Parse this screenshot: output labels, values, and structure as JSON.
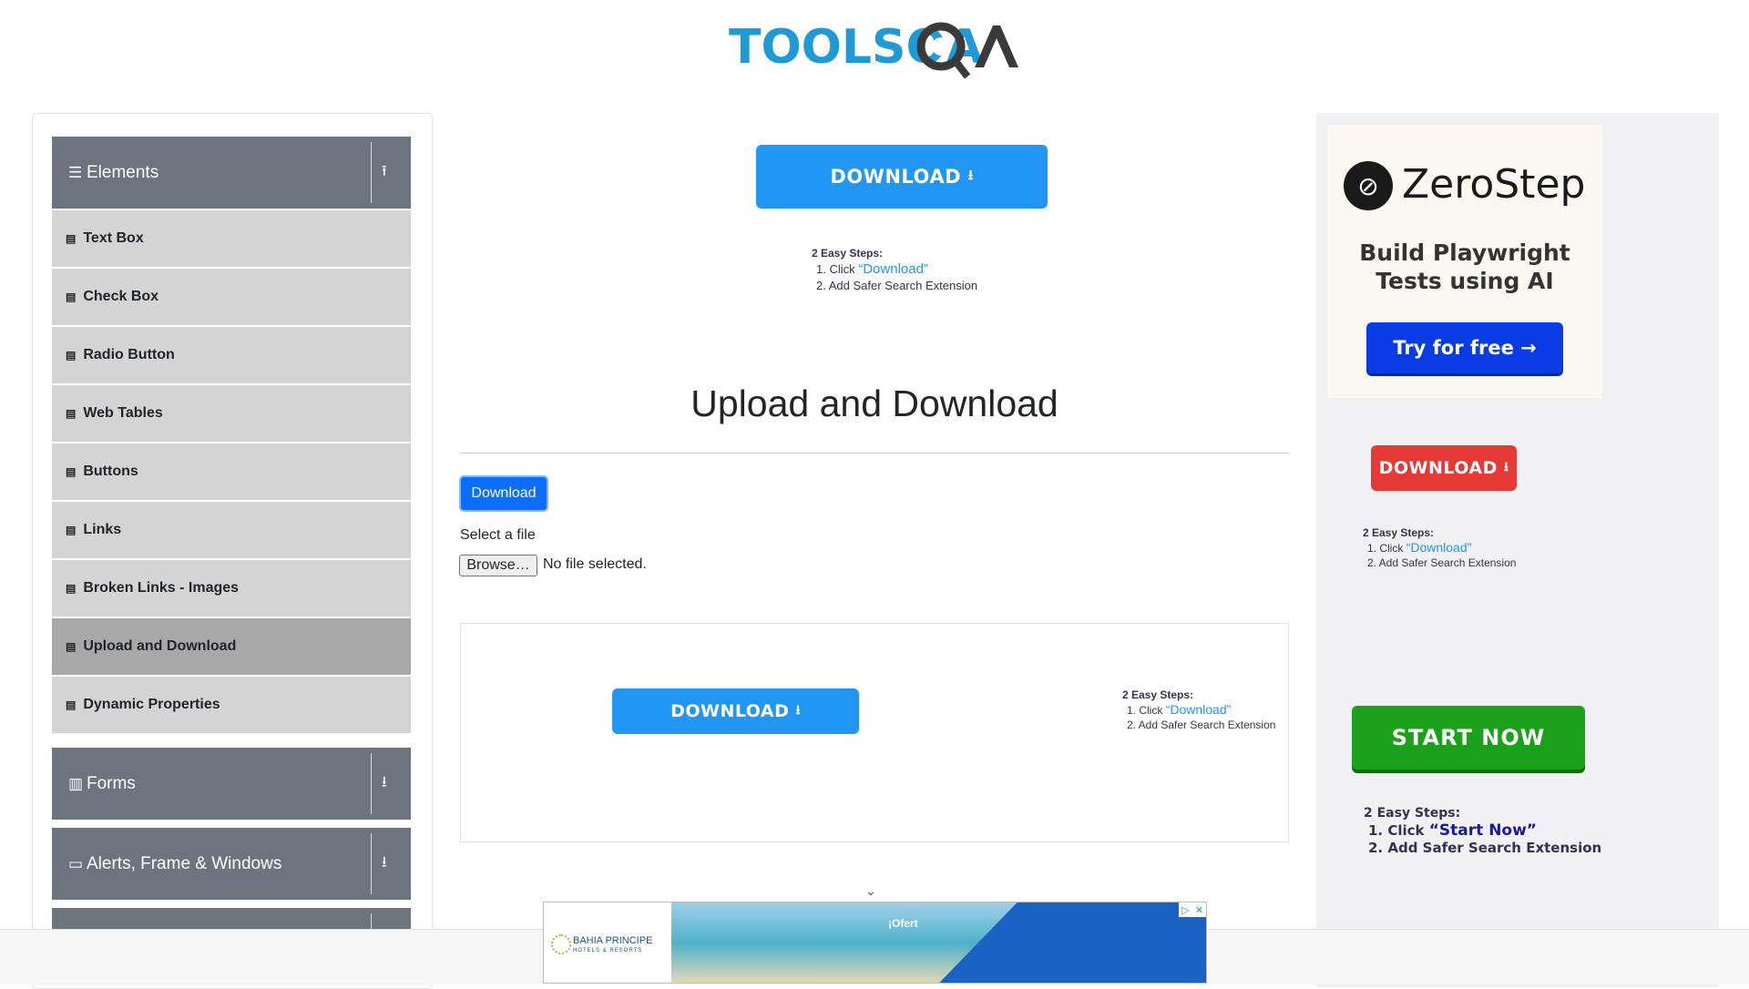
{
  "header": {
    "logo_text": "TOOLSQA"
  },
  "sidebar": {
    "elements_group": {
      "label": "Elements",
      "icon": "hamburger-icon",
      "toggle_icon": "collapse-arrow-icon"
    },
    "items": [
      {
        "label": "Text Box"
      },
      {
        "label": "Check Box"
      },
      {
        "label": "Radio Button"
      },
      {
        "label": "Web Tables"
      },
      {
        "label": "Buttons"
      },
      {
        "label": "Links"
      },
      {
        "label": "Broken Links - Images"
      },
      {
        "label": "Upload and Download",
        "active": true
      },
      {
        "label": "Dynamic Properties"
      }
    ],
    "groups": [
      {
        "label": "Forms",
        "icon": "form-icon",
        "toggle_icon": "expand-arrow-icon"
      },
      {
        "label": "Alerts, Frame & Windows",
        "icon": "window-icon",
        "toggle_icon": "expand-arrow-icon"
      }
    ]
  },
  "main": {
    "top_ad": {
      "button_label": "DOWNLOAD",
      "steps_title": "2 Easy Steps:",
      "step1_prefix": "1. Click ",
      "step1_link": "“Download”",
      "step2": "2. Add Safer Search Extension"
    },
    "title": "Upload and Download",
    "download_button": "Download",
    "select_label": "Select a file",
    "browse_label": "Browse…",
    "file_status": "No file selected.",
    "mid_ad": {
      "button_label": "DOWNLOAD",
      "steps_title": "2 Easy Steps:",
      "step1_prefix": "1. Click ",
      "step1_link": "“Download”",
      "step2": "2. Add Safer Search Extension"
    }
  },
  "right_ad": {
    "zerostep": {
      "brand": "ZeroStep",
      "headline_line1": "Build Playwright",
      "headline_line2": "Tests using AI",
      "cta": "Try for free →"
    },
    "download": {
      "button_label": "DOWNLOAD",
      "steps_title": "2 Easy Steps:",
      "step1_prefix": "1. Click ",
      "step1_link": "“Download”",
      "step2": "2. Add Safer Search Extension"
    },
    "start": {
      "button_label": "START NOW",
      "steps_title": "2 Easy Steps:",
      "step1_prefix": "1. Click ",
      "step1_link": "“Start Now”",
      "step2": "2. Add Safer Search Extension"
    }
  },
  "bottom_banner": {
    "brand": "BAHIA PRINCIPE",
    "brand_sub": "HOTELS & RESORTS",
    "offer_text": "¡Ofert"
  },
  "colors": {
    "sidebar_header": "#6c757d",
    "menu_item": "#d4d4d4",
    "menu_active": "#a8a8a8",
    "primary": "#0d6efd",
    "ad_blue": "#2196f3",
    "ad_red": "#e53935",
    "ad_green": "#1aa01a"
  }
}
